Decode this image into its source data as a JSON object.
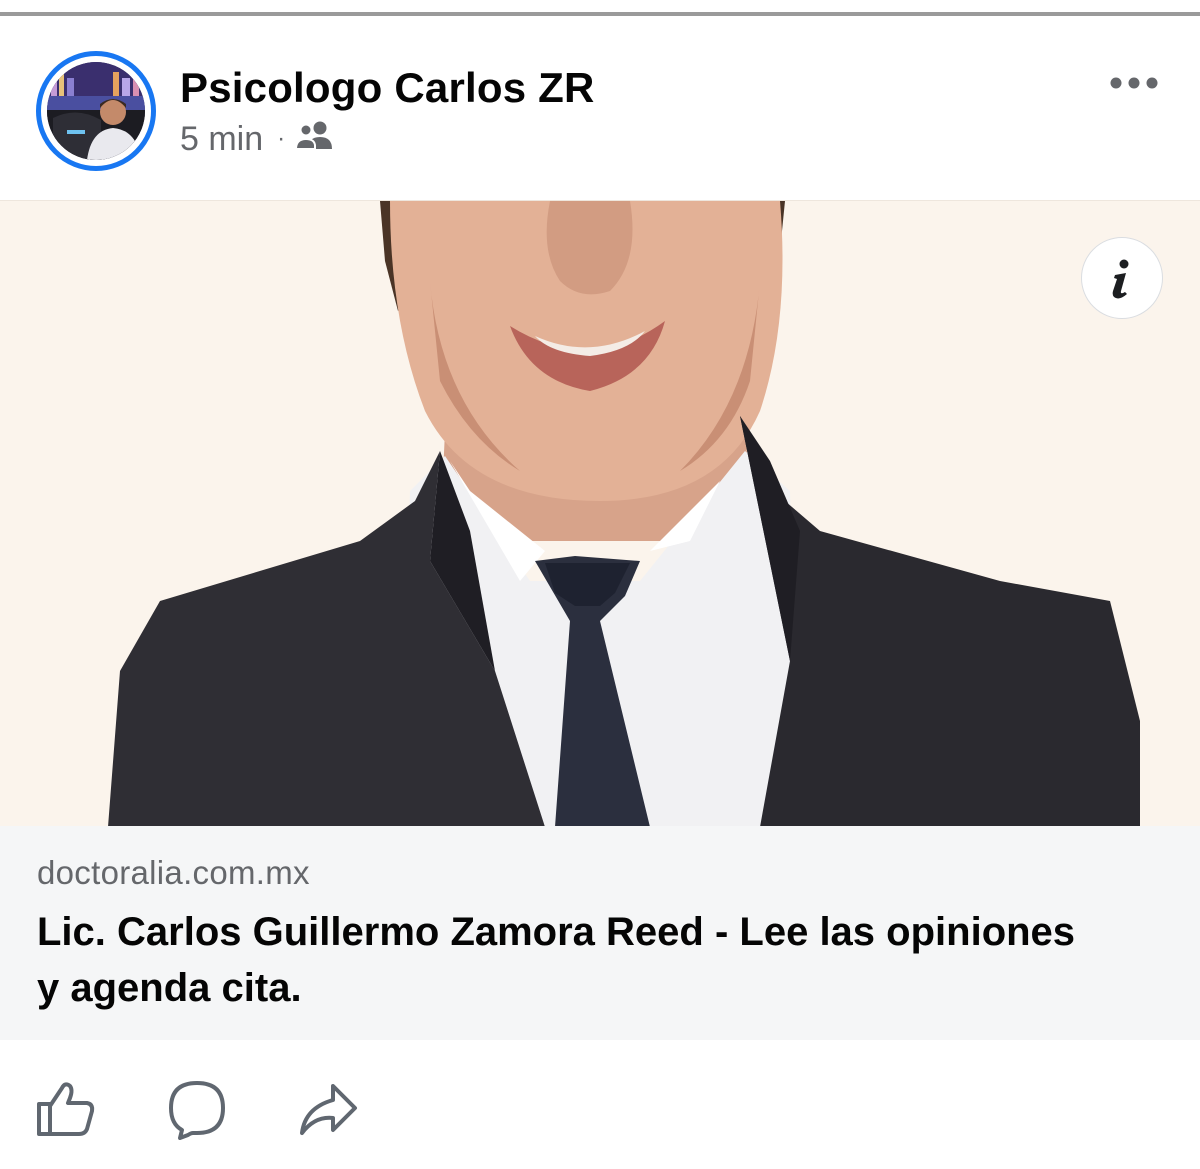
{
  "post": {
    "author": "Psicologo Carlos ZR",
    "time": "5 min",
    "separator": "·",
    "audience_icon": "group-icon",
    "more_icon": "more-options-icon"
  },
  "media": {
    "info_icon": "info-icon"
  },
  "link": {
    "domain": "doctoralia.com.mx",
    "title": "Lic. Carlos Guillermo Zamora Reed - Lee las opiniones y agenda cita."
  },
  "actions": {
    "like_icon": "thumbs-up-icon",
    "comment_icon": "comment-icon",
    "share_icon": "share-icon"
  },
  "colors": {
    "accent": "#1877f2",
    "secondary_text": "#65676b",
    "link_card_bg": "#f5f6f7",
    "media_bg": "#fbf4ec"
  }
}
